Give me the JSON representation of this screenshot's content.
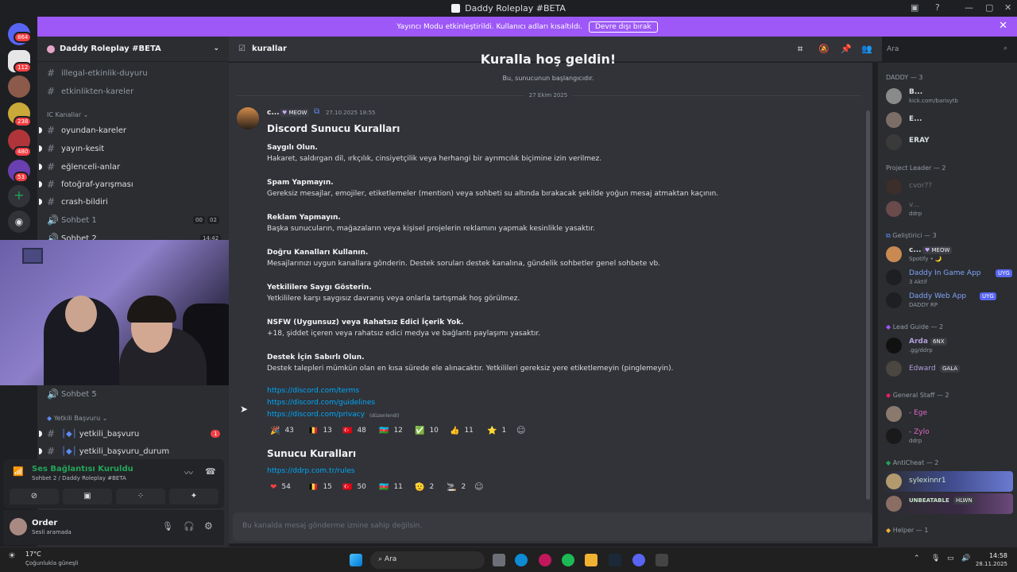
{
  "window": {
    "title": "Daddy Roleplay #BETA"
  },
  "banner": {
    "text": "Yayıncı Modu etkinleştirildi. Kullanıcı adları kısaltıldı.",
    "button": "Devre dışı bırak"
  },
  "rail": {
    "badges": [
      "864",
      "112",
      "238",
      "480",
      "53"
    ]
  },
  "sidebar": {
    "server_name": "Daddy Roleplay #BETA",
    "channels_top": [
      "illegal-etkinlik-duyuru",
      "etkinlikten-kareler"
    ],
    "category_ic": "IC Kanallar",
    "channels_ic": [
      "oyundan-kareler",
      "yayın-kesit",
      "eğlenceli-anlar",
      "fotoğraf-yarışması",
      "crash-bildiri"
    ],
    "voice1": {
      "name": "Sohbet 1",
      "a": "00",
      "b": "02"
    },
    "voice2": {
      "name": "Sohbet 2",
      "time": "14:42"
    },
    "voice5": {
      "name": "Sohbet 5"
    },
    "category_yetkili": "Yetkili Başvuru",
    "channels_yetkili": [
      {
        "name": "yetkili_başvuru",
        "badge": "1"
      },
      {
        "name": "yetkili_başvuru_durum"
      }
    ]
  },
  "voice_panel": {
    "status": "Ses Bağlantısı Kuruldu",
    "location": "Sohbet 2 / Daddy Roleplay #BETA"
  },
  "user_panel": {
    "name": "Order",
    "status": "Sesli aramada"
  },
  "header": {
    "channel": "kurallar"
  },
  "search": {
    "placeholder": "Ara"
  },
  "chat": {
    "welcome_title": "Kuralla hoş geldin!",
    "welcome_sub": "Bu, sunucunun başlangıcıdır.",
    "date_divider": "27 Ekim 2025",
    "message": {
      "author": "c...",
      "tag": "MEOW",
      "timestamp": "27.10.2025 18:55",
      "heading": "Discord Sunucu Kuralları",
      "rules": [
        {
          "title": "Saygılı Olun.",
          "body": "Hakaret, saldırgan dil, ırkçılık, cinsiyetçilik veya herhangi bir ayrımcılık biçimine izin verilmez."
        },
        {
          "title": "Spam Yapmayın.",
          "body": "Gereksiz mesajlar, emojiler, etiketlemeler (mention) veya sohbeti su altında bırakacak şekilde yoğun mesaj atmaktan kaçının."
        },
        {
          "title": "Reklam Yapmayın.",
          "body": "Başka sunucuların, mağazaların veya kişisel projelerin reklamını yapmak kesinlikle yasaktır."
        },
        {
          "title": "Doğru Kanalları Kullanın.",
          "body": "Mesajlarınızı uygun kanallara gönderin. Destek soruları destek kanalına, gündelik sohbetler genel sohbete vb."
        },
        {
          "title": "Yetkililere Saygı Gösterin.",
          "body": "Yetkililere karşı saygısız davranış veya onlarla tartışmak hoş görülmez."
        },
        {
          "title": "NSFW (Uygunsuz) veya Rahatsız Edici İçerik Yok.",
          "body": "+18, şiddet içeren veya rahatsız edici medya ve bağlantı paylaşımı yasaktır."
        },
        {
          "title": "Destek İçin Sabırlı Olun.",
          "body": "Destek talepleri mümkün olan en kısa sürede ele alınacaktır. Yetkilileri gereksiz yere etiketlemeyin (pinglemeyin)."
        }
      ],
      "links": [
        "https://discord.com/terms",
        "https://discord.com/guidelines",
        "https://discord.com/privacy"
      ],
      "edited": "(düzenlendi)",
      "reactions": [
        {
          "emoji": "🎉",
          "count": "43"
        },
        {
          "emoji": "🇧🇪",
          "count": "13"
        },
        {
          "emoji": "🇹🇷",
          "count": "48"
        },
        {
          "emoji": "🇦🇿",
          "count": "12"
        },
        {
          "emoji": "✅",
          "count": "10"
        },
        {
          "emoji": "👍",
          "count": "11"
        },
        {
          "emoji": "⭐",
          "count": "1"
        }
      ]
    },
    "message2": {
      "heading": "Sunucu Kuralları",
      "link": "https://ddrp.com.tr/rules",
      "reactions": [
        {
          "emoji": "❤",
          "count": "54"
        },
        {
          "emoji": "🇧🇪",
          "count": "15"
        },
        {
          "emoji": "🇹🇷",
          "count": "50"
        },
        {
          "emoji": "🇦🇿",
          "count": "11"
        },
        {
          "emoji": "🫡",
          "count": "2"
        },
        {
          "emoji": "🚬",
          "count": "2"
        }
      ]
    },
    "input_placeholder": "Bu kanalda mesaj gönderme iznine sahip değilsin."
  },
  "members": {
    "groups": [
      {
        "title": "DADDY — 3"
      },
      {
        "title": "Project Leader — 2"
      },
      {
        "title": "Geliştirici — 3"
      },
      {
        "title": "Lead Guide — 2"
      },
      {
        "title": "General Staff — 2"
      },
      {
        "title": "AntiCheat — 2"
      },
      {
        "title": "Helper — 1"
      }
    ],
    "m": {
      "b": "B...",
      "b_sub": "kick.com/barisytb",
      "e": "E...",
      "eray": "ERAY",
      "pl1": "cvor??",
      "pl2": "v...",
      "pl2_sub": "ddrp",
      "dev1": "c...",
      "dev1_tag": "MEOW",
      "dev1_sub": "Spotify • 🌙",
      "dev2": "Daddy In Game App",
      "dev2_tag": "UYG",
      "dev2_sub": "3 Aktif",
      "dev3": "Daddy Web App",
      "dev3_tag": "UYG",
      "dev3_sub": "DADDY RP",
      "lg1": "Arda",
      "lg1_tag": "6NX",
      "lg1_sub": ".gg/ddrp",
      "lg2": "Edward",
      "lg2_tag": "GALA",
      "gs1": "- Ege",
      "gs2": "- Zylo",
      "gs2_sub": "ddrp",
      "ac1": "sylexinnr1",
      "ac2": "UNBEATABLE",
      "ac2_tag": "HLWN"
    }
  },
  "taskbar": {
    "weather": "17°C",
    "weather_sub": "Çoğunlukla güneşli",
    "search": "Ara",
    "time": "14:58",
    "date": "28.11.2025"
  }
}
